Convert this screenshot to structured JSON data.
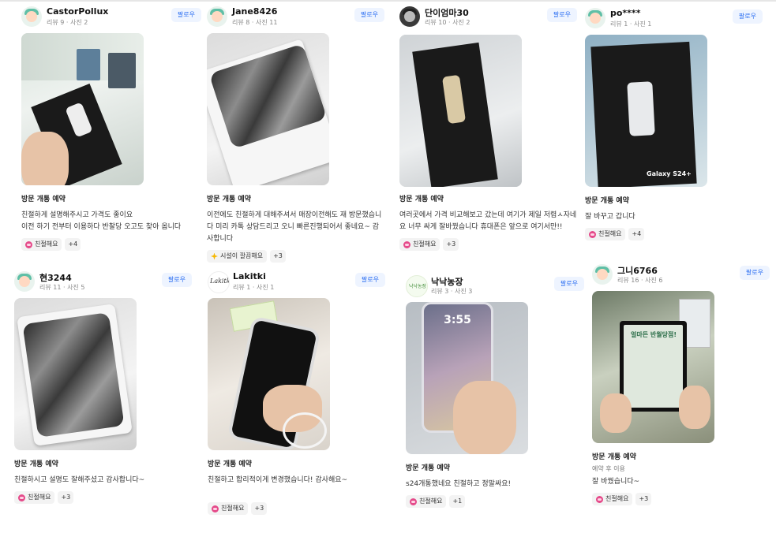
{
  "follow_label": "팔로우",
  "visit_tag": "방문 개통 예약",
  "reviews": [
    {
      "name": "CastorPollux",
      "meta": "리뷰 9 · 사진 2",
      "text": "친절하게 설명해주시고 가격도 좋이요\n이전 하기 전부터 이용하다 반찰당 오고도 찾아 옵니다",
      "badge": "친절해요",
      "badge_icon": "heart-icon",
      "more": "+4"
    },
    {
      "name": "Jane8426",
      "meta": "리뷰 8 · 사진 11",
      "text": "이전에도 친절하게 대해주셔서 매장이전해도 재 방문했습니다 미리 카톡 상담드리고 오니 빠른진행되어서 좋네요~ 감사합니다",
      "badge": "시설이 깔끔해요",
      "badge_icon": "sparkle-icon",
      "more": "+3"
    },
    {
      "name": "단이엄마30",
      "meta": "리뷰 10 · 사진 2",
      "text": "여러곳에서 가격 비교해보고 갔는데 여기가 제일 저렴ㅅ자네요 너무 싸게 잘바꿨습니다 휴대폰은 앞으로 여기서만!!",
      "badge": "친절해요",
      "badge_icon": "heart-icon",
      "more": "+3"
    },
    {
      "name": "po****",
      "meta": "리뷰 1 · 사진 1",
      "text": "잘 바꾸고 갑니다",
      "badge": "친절해요",
      "badge_icon": "heart-icon",
      "more": "+4",
      "photo_caption": "Galaxy S24+"
    },
    {
      "name": "현3244",
      "meta": "리뷰 11 · 사진 5",
      "text": "친절하시고 설명도 잘해주셨고 감사합니다~",
      "badge": "친절해요",
      "badge_icon": "heart-icon",
      "more": "+3"
    },
    {
      "name": "Lakitki",
      "meta": "리뷰 1 · 사진 1",
      "text": "친절하고 합리적이게 변경했습니다! 감사해요~",
      "badge": "친절해요",
      "badge_icon": "heart-icon",
      "more": "+3",
      "avatar_text": "Lakitki"
    },
    {
      "name": "낙낙농장",
      "meta": "리뷰 3 · 사진 3",
      "text": "s24개통했네요 친절하고 정말싸요!",
      "badge": "친절해요",
      "badge_icon": "heart-icon",
      "more": "+1",
      "avatar_text": "낙낙농장",
      "photo_clock": "3:55"
    },
    {
      "name": "그니6766",
      "meta": "리뷰 16 · 사진 6",
      "sub": "예약 후 이용",
      "text": "잘 바꿨습니다~",
      "badge": "친절해요",
      "badge_icon": "heart-icon",
      "more": "+3",
      "photo_sign": "얼마든 반월당점!"
    }
  ]
}
